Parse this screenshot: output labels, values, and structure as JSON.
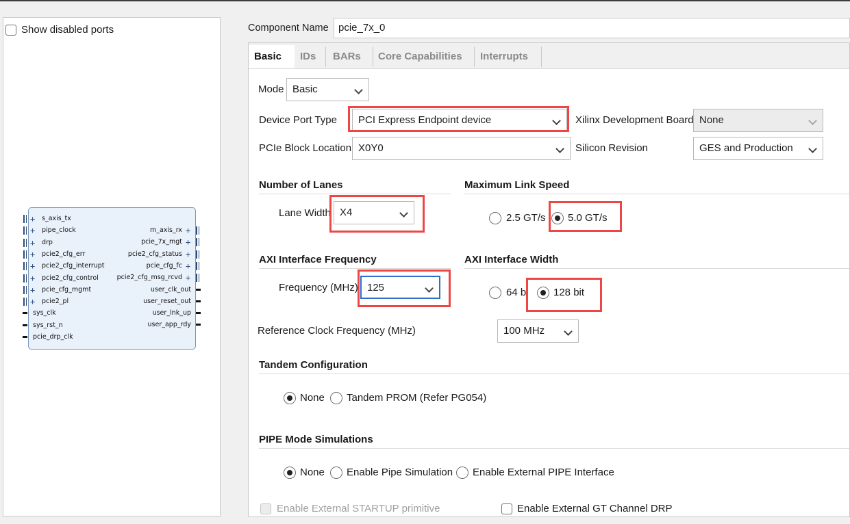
{
  "left_panel": {
    "show_disabled_ports_label": "Show disabled ports",
    "show_disabled_ports_checked": false,
    "left_ports": [
      "s_axis_tx",
      "pipe_clock",
      "drp",
      "pcie2_cfg_err",
      "pcie2_cfg_interrupt",
      "pcie2_cfg_control",
      "pcie_cfg_mgmt",
      "pcie2_pl",
      "sys_clk",
      "sys_rst_n",
      "pcie_drp_clk"
    ],
    "right_ports": [
      "m_axis_rx",
      "pcie_7x_mgt",
      "pcie2_cfg_status",
      "pcie_cfg_fc",
      "pcie2_cfg_msg_rcvd",
      "user_clk_out",
      "user_reset_out",
      "user_lnk_up",
      "user_app_rdy"
    ]
  },
  "component": {
    "label": "Component Name",
    "value": "pcie_7x_0"
  },
  "tabs": [
    {
      "label": "Basic",
      "active": true
    },
    {
      "label": "IDs",
      "active": false
    },
    {
      "label": "BARs",
      "active": false
    },
    {
      "label": "Core Capabilities",
      "active": false
    },
    {
      "label": "Interrupts",
      "active": false
    }
  ],
  "basic": {
    "mode_label": "Mode",
    "mode_value": "Basic",
    "device_port_type_label": "Device Port Type",
    "device_port_type_value": "PCI Express Endpoint device",
    "dev_board_label": "Xilinx Development Board",
    "dev_board_value": "None",
    "pcie_block_location_label": "PCIe Block Location",
    "pcie_block_location_value": "X0Y0",
    "silicon_revision_label": "Silicon Revision",
    "silicon_revision_value": "GES and Production",
    "lanes_section": "Number of Lanes",
    "lane_width_label": "Lane Width",
    "lane_width_value": "X4",
    "link_speed_section": "Maximum Link Speed",
    "link_speed_options": [
      "2.5 GT/s",
      "5.0 GT/s"
    ],
    "link_speed_selected": "5.0 GT/s",
    "axi_freq_section": "AXI Interface Frequency",
    "freq_label": "Frequency (MHz)",
    "freq_value": "125",
    "axi_width_section": "AXI Interface Width",
    "axi_width_options": [
      "64 bit",
      "128 bit"
    ],
    "axi_width_selected": "128 bit",
    "ref_clock_label": "Reference Clock Frequency (MHz)",
    "ref_clock_value": "100 MHz",
    "tandem_section": "Tandem Configuration",
    "tandem_options": [
      "None",
      "Tandem PROM (Refer PG054)"
    ],
    "tandem_selected": "None",
    "pipe_section": "PIPE Mode Simulations",
    "pipe_options": [
      "None",
      "Enable Pipe Simulation",
      "Enable External PIPE Interface"
    ],
    "pipe_selected": "None",
    "startup_label": "Enable External STARTUP primitive",
    "startup_enabled": false,
    "gt_drp_label": "Enable External GT Channel DRP",
    "gt_drp_checked": false
  },
  "highlight_color": "#ee4545"
}
